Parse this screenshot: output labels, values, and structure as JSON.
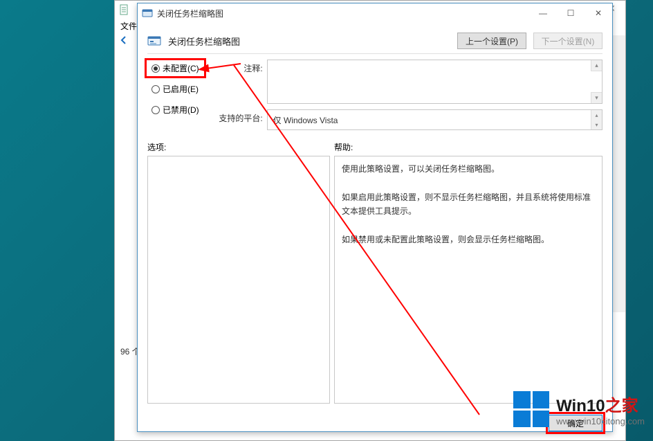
{
  "bg": {
    "menu_file": "文件",
    "status": "96 个",
    "close_glyph": "✕"
  },
  "dialog": {
    "title": "关闭任务栏缩略图",
    "header_title": "关闭任务栏缩略图",
    "prev_btn": "上一个设置(P)",
    "next_btn": "下一个设置(N)",
    "radios": {
      "unconfigured": "未配置(C)",
      "enabled": "已启用(E)",
      "disabled": "已禁用(D)"
    },
    "comment_label": "注释:",
    "platform_label": "支持的平台:",
    "platform_value": "仅 Windows Vista",
    "options_label": "选项:",
    "help_label": "帮助:",
    "help_text": "使用此策略设置，可以关闭任务栏缩略图。\n\n如果启用此策略设置，则不显示任务栏缩略图，并且系统将使用标准文本提供工具提示。\n\n如果禁用或未配置此策略设置，则会显示任务栏缩略图。",
    "ok_btn": "确定"
  },
  "watermark": {
    "brand_a": "Win10",
    "brand_b": "之家",
    "url": "www.win10xitong.com"
  },
  "glyphs": {
    "min": "—",
    "max": "☐",
    "close": "✕",
    "up": "▴",
    "down": "▾",
    "back": "⬅"
  }
}
